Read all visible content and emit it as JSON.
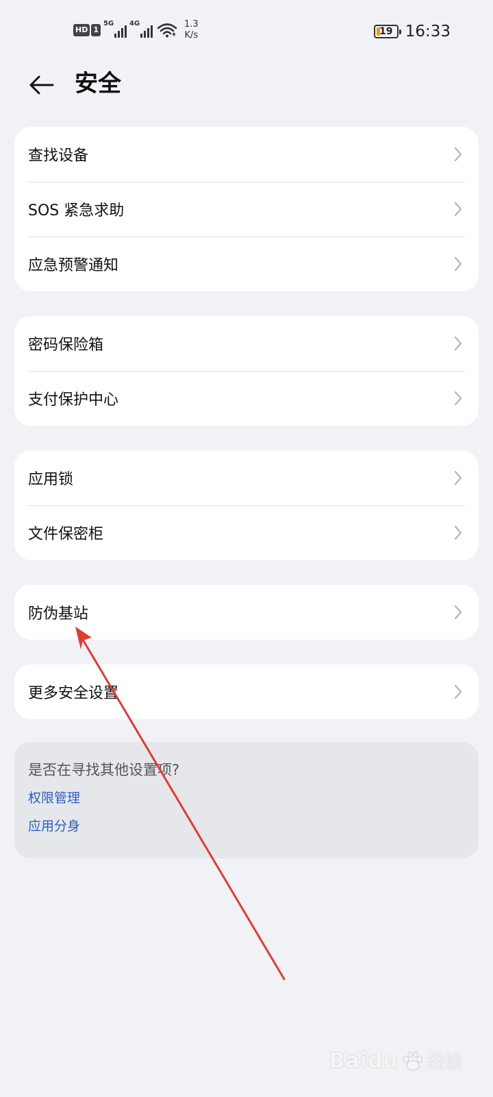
{
  "status_bar": {
    "hd": "HD",
    "sim": "1",
    "signal1_gen": "5G",
    "signal2_gen": "4G",
    "net_speed_value": "1.3",
    "net_speed_unit": "K/s",
    "battery_level": "19",
    "battery_fill_fraction": 0.19,
    "battery_color": "#e89a1c",
    "time": "16:33"
  },
  "header": {
    "back_icon": "arrow-left-icon",
    "title": "安全"
  },
  "groups": [
    {
      "items": [
        {
          "label": "查找设备"
        },
        {
          "label": "SOS 紧急求助"
        },
        {
          "label": "应急预警通知"
        }
      ]
    },
    {
      "items": [
        {
          "label": "密码保险箱"
        },
        {
          "label": "支付保护中心"
        }
      ]
    },
    {
      "items": [
        {
          "label": "应用锁"
        },
        {
          "label": "文件保密柜"
        }
      ]
    },
    {
      "items": [
        {
          "label": "防伪基站"
        }
      ]
    },
    {
      "items": [
        {
          "label": "更多安全设置"
        }
      ]
    }
  ],
  "suggestions": {
    "question": "是否在寻找其他设置项?",
    "links": [
      {
        "label": "权限管理"
      },
      {
        "label": "应用分身"
      }
    ],
    "link_color": "#2a5fc8"
  },
  "annotation": {
    "arrow_color": "#e33b2e",
    "arrow_icon": "red-arrow-annotation"
  },
  "watermark": {
    "brand": "Baidu",
    "sub": "经验",
    "icon": "baidu-paw-icon"
  },
  "colors": {
    "background": "#f1f2f6",
    "card": "#ffffff",
    "chevron": "#b5b5b5"
  }
}
